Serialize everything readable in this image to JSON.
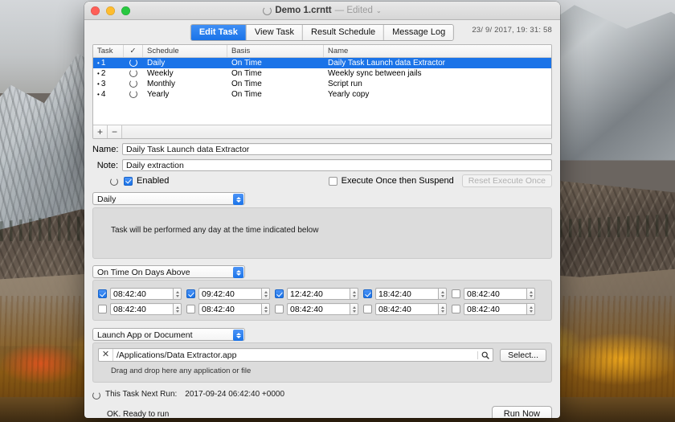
{
  "window": {
    "title": "Demo 1.crntt",
    "edited_label": "— Edited",
    "chevron": "⌄",
    "doc_icon": "document-circle-icon"
  },
  "tabs": [
    {
      "label": "Edit Task",
      "active": true
    },
    {
      "label": "View Task",
      "active": false
    },
    {
      "label": "Result Schedule",
      "active": false
    },
    {
      "label": "Message Log",
      "active": false
    }
  ],
  "clock": "23/ 9/ 2017, 19: 31: 58",
  "table": {
    "headers": [
      "Task",
      "✓",
      "Schedule",
      "Basis",
      "Name"
    ],
    "rows": [
      {
        "num": "1",
        "schedule": "Daily",
        "basis": "On Time",
        "name": "Daily Task Launch data Extractor",
        "selected": true
      },
      {
        "num": "2",
        "schedule": "Weekly",
        "basis": "On Time",
        "name": "Weekly sync between jails",
        "selected": false
      },
      {
        "num": "3",
        "schedule": "Monthly",
        "basis": "On Time",
        "name": "Script run",
        "selected": false
      },
      {
        "num": "4",
        "schedule": "Yearly",
        "basis": "On Time",
        "name": "Yearly copy",
        "selected": false
      }
    ],
    "add_label": "+",
    "remove_label": "−"
  },
  "fields": {
    "name_label": "Name:",
    "name_value": "Daily Task Launch data Extractor",
    "note_label": "Note:",
    "note_value": "Daily extraction"
  },
  "enabled_row": {
    "enabled_label": "Enabled",
    "enabled_checked": true,
    "execute_once_label": "Execute Once then Suspend",
    "execute_once_checked": false,
    "reset_button": "Reset Execute Once",
    "reset_disabled": true
  },
  "schedule_popup": {
    "value": "Daily",
    "description": "Task will be performed any day at the time indicated below"
  },
  "basis_popup": {
    "value": "On Time On Days Above"
  },
  "times": [
    {
      "value": "08:42:40",
      "checked": true
    },
    {
      "value": "09:42:40",
      "checked": true
    },
    {
      "value": "12:42:40",
      "checked": true
    },
    {
      "value": "18:42:40",
      "checked": true
    },
    {
      "value": "08:42:40",
      "checked": false
    },
    {
      "value": "08:42:40",
      "checked": false
    },
    {
      "value": "08:42:40",
      "checked": false
    },
    {
      "value": "08:42:40",
      "checked": false
    },
    {
      "value": "08:42:40",
      "checked": false
    },
    {
      "value": "08:42:40",
      "checked": false
    }
  ],
  "action": {
    "popup_value": "Launch App or Document",
    "path_value": "/Applications/Data Extractor.app",
    "clear_label": "✕",
    "select_label": "Select...",
    "drag_hint": "Drag and drop here any application or file"
  },
  "footer": {
    "next_run_label": "This Task Next Run:",
    "next_run_value": "2017-09-24 06:42:40 +0000",
    "status": "OK. Ready to run",
    "run_button": "Run Now"
  },
  "colors": {
    "accent": "#1a73e8",
    "window_bg": "#ececec",
    "panel_bg": "#dcdcdc",
    "close": "#ff5f57",
    "minimize": "#febc2e",
    "zoom": "#28c840"
  }
}
